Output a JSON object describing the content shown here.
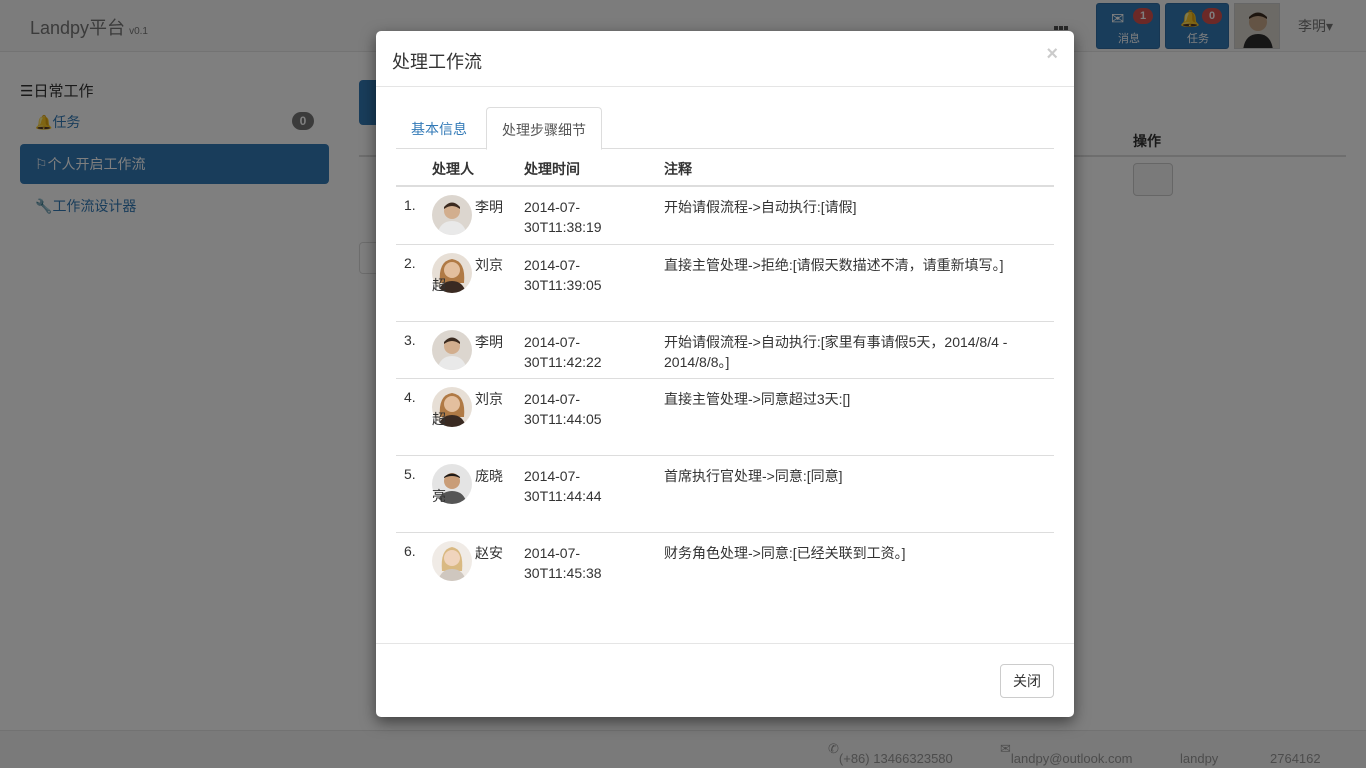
{
  "navbar": {
    "brand": "Landpy平台",
    "version": "v0.1",
    "messages": {
      "label": "消息",
      "count": "1"
    },
    "tasks": {
      "label": "任务",
      "count": "0"
    },
    "user": "李明"
  },
  "sidebar": {
    "title": "日常工作",
    "items": [
      {
        "label": "任务",
        "badge": "0"
      },
      {
        "label": "个人开启工作流"
      },
      {
        "label": "工作流设计器"
      }
    ]
  },
  "main": {
    "op_header": "操作"
  },
  "footer": {
    "phone": "(+86) 13466323580",
    "email": "landpy@outlook.com",
    "qq": "landpy",
    "extra": "2764162"
  },
  "modal": {
    "title": "处理工作流",
    "close": "×",
    "tabs": [
      "基本信息",
      "处理步骤细节"
    ],
    "table": {
      "headers": [
        "处理人",
        "处理时间",
        "注释"
      ],
      "rows": [
        {
          "idx": "1.",
          "name": "李明",
          "avatar": "male-a",
          "time": "2014-07-30T11:38:19",
          "note": "开始请假流程->自动执行:[请假]"
        },
        {
          "idx": "2.",
          "name": "刘京超",
          "avatar": "female-a",
          "time": "2014-07-30T11:39:05",
          "note": "直接主管处理->拒绝:[请假天数描述不清，请重新填写。]"
        },
        {
          "idx": "3.",
          "name": "李明",
          "avatar": "male-a",
          "time": "2014-07-30T11:42:22",
          "note": "开始请假流程->自动执行:[家里有事请假5天，2014/8/4 - 2014/8/8。]"
        },
        {
          "idx": "4.",
          "name": "刘京超",
          "avatar": "female-a",
          "time": "2014-07-30T11:44:05",
          "note": "直接主管处理->同意超过3天:[]"
        },
        {
          "idx": "5.",
          "name": "庞晓亮",
          "avatar": "male-b",
          "time": "2014-07-30T11:44:44",
          "note": "首席执行官处理->同意:[同意]"
        },
        {
          "idx": "6.",
          "name": "赵安",
          "avatar": "female-b",
          "time": "2014-07-30T11:45:38",
          "note": "财务角色处理->同意:[已经关联到工资。]"
        }
      ]
    },
    "close_button": "关闭"
  }
}
